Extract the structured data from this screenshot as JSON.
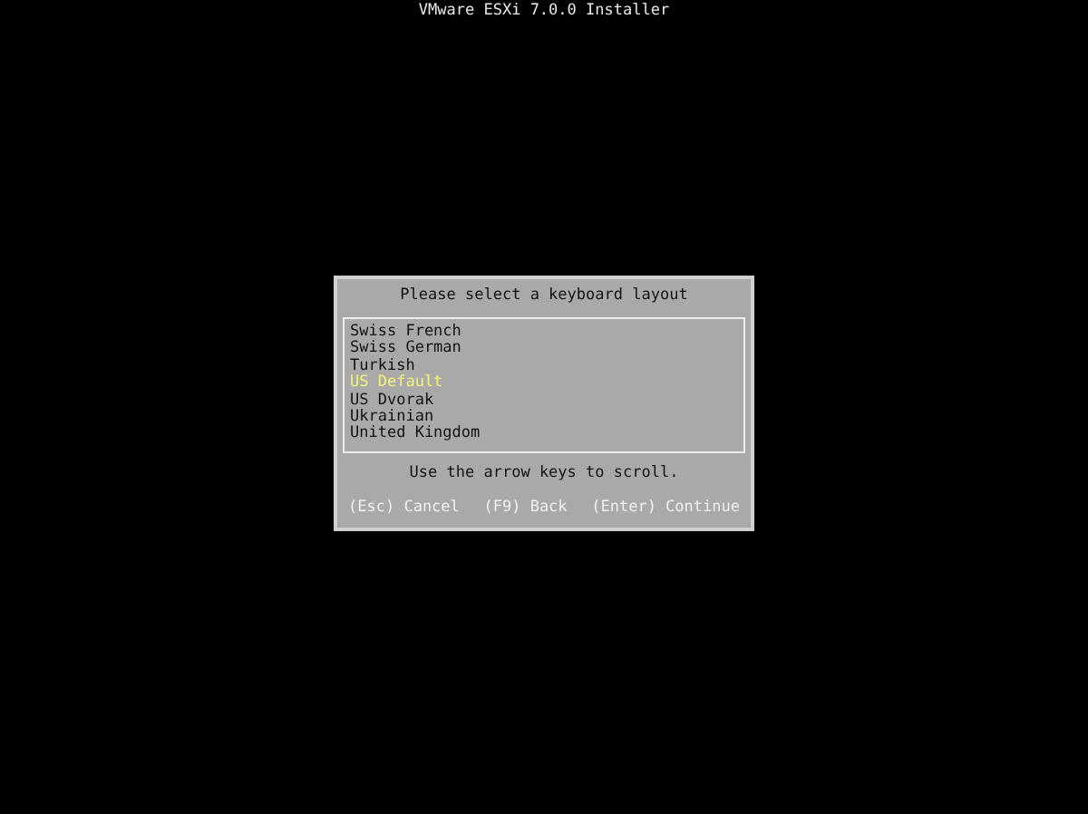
{
  "window": {
    "title": "VMware ESXi 7.0.0 Installer"
  },
  "dialog": {
    "title": "Please select a keyboard layout",
    "items": [
      {
        "label": "Swiss French",
        "selected": false
      },
      {
        "label": "Swiss German",
        "selected": false
      },
      {
        "label": "Turkish",
        "selected": false
      },
      {
        "label": "US Default",
        "selected": true
      },
      {
        "label": "US Dvorak",
        "selected": false
      },
      {
        "label": "Ukrainian",
        "selected": false
      },
      {
        "label": "United Kingdom",
        "selected": false
      }
    ],
    "hint": "Use the arrow keys to scroll.",
    "actions": [
      "(Esc) Cancel",
      "(F9) Back",
      "(Enter) Continue"
    ]
  }
}
